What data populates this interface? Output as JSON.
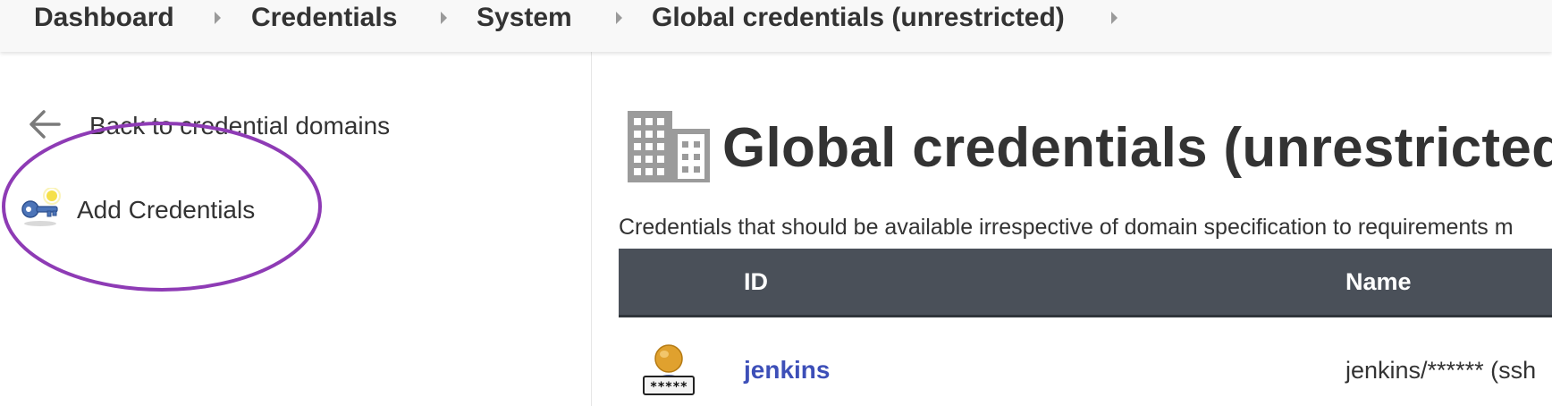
{
  "breadcrumb": {
    "items": [
      "Dashboard",
      "Credentials",
      "System",
      "Global credentials (unrestricted)"
    ]
  },
  "sidebar": {
    "back_label": "Back to credential domains",
    "add_label": "Add Credentials"
  },
  "main": {
    "title": "Global credentials (unrestricted)",
    "description": "Credentials that should be available irrespective of domain specification to requirements m",
    "table": {
      "columns": [
        "ID",
        "Name"
      ],
      "rows": [
        {
          "id": "jenkins",
          "name": "jenkins/****** (ssh"
        }
      ]
    }
  },
  "colors": {
    "annotation": "#8e3bb5",
    "table_header": "#4a5059",
    "link": "#3d4fb8"
  }
}
